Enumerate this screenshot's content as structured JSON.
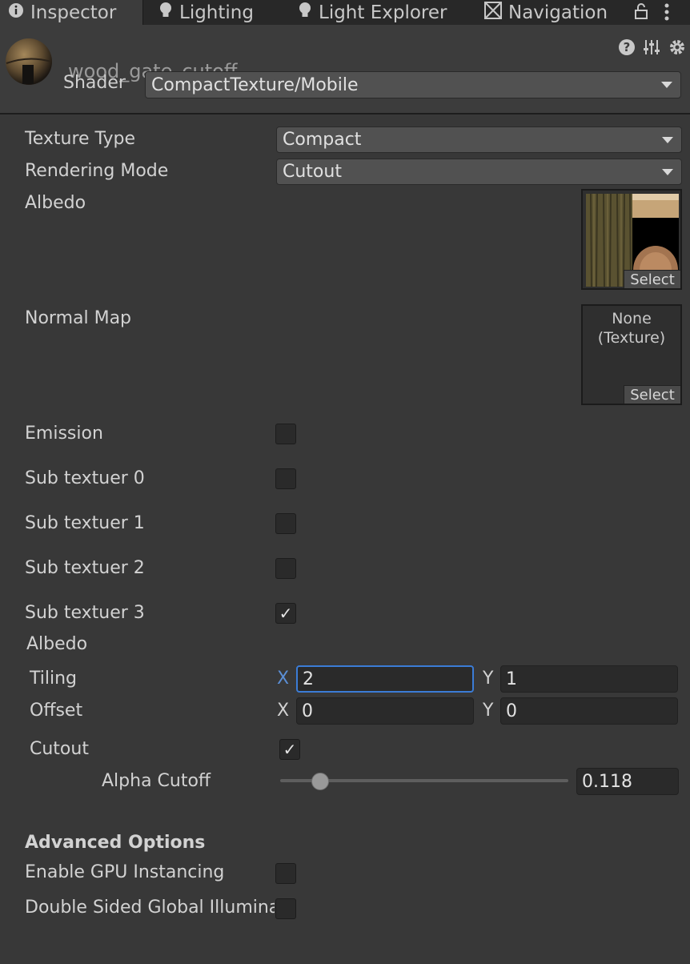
{
  "tabs": [
    {
      "label": "Inspector",
      "icon": "info-icon"
    },
    {
      "label": "Lighting",
      "icon": "lightbulb-icon"
    },
    {
      "label": "Light Explorer",
      "icon": "lightbulb-icon"
    },
    {
      "label": "Navigation",
      "icon": "navigation-icon"
    }
  ],
  "header": {
    "material_name": "wood_gate_cutoff",
    "shader_label": "Shader",
    "shader_value": "CompactTexture/Mobile"
  },
  "properties": {
    "texture_type_label": "Texture Type",
    "texture_type_value": "Compact",
    "rendering_mode_label": "Rendering Mode",
    "rendering_mode_value": "Cutout",
    "albedo_label": "Albedo",
    "normal_map_label": "Normal Map",
    "normal_map_none": "None",
    "normal_map_type": "(Texture)",
    "select_label": "Select",
    "emission_label": "Emission",
    "emission_checked": false,
    "sub_texturers": [
      {
        "label": "Sub textuer 0",
        "checked": false
      },
      {
        "label": "Sub textuer 1",
        "checked": false
      },
      {
        "label": "Sub textuer 2",
        "checked": false
      },
      {
        "label": "Sub textuer 3",
        "checked": true
      }
    ],
    "albedo_section_label": "Albedo",
    "tiling_label": "Tiling",
    "tiling_x": "2",
    "tiling_y": "1",
    "offset_label": "Offset",
    "offset_x": "0",
    "offset_y": "0",
    "axis_x": "X",
    "axis_y": "Y",
    "cutout_label": "Cutout",
    "cutout_checked": true,
    "alpha_cutoff_label": "Alpha Cutoff",
    "alpha_cutoff_value": "0.118",
    "check_mark": "✓"
  },
  "advanced": {
    "title": "Advanced Options",
    "gpu_instancing_label": "Enable GPU Instancing",
    "gpu_instancing_checked": false,
    "double_sided_label": "Double Sided Global Illumina",
    "double_sided_checked": false
  },
  "colors": {
    "background": "#383838",
    "focus_border": "#3b7cd6"
  }
}
